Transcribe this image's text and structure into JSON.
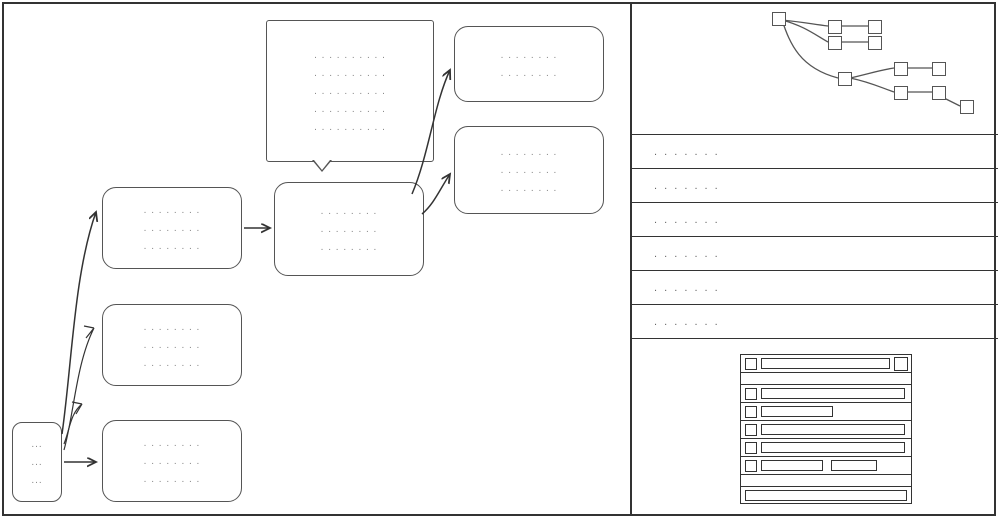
{
  "placeholder_line": ". . . . . . . . .",
  "row_placeholder": ". . . . . . .",
  "flow": {
    "root": {
      "lines": [
        "...",
        "...",
        "..."
      ]
    },
    "n1": {
      "lines": [
        ". . . . . . . .",
        ". . . . . . . .",
        ". . . . . . . ."
      ]
    },
    "n2": {
      "lines": [
        ". . . . . . . .",
        ". . . . . . . .",
        ". . . . . . . ."
      ]
    },
    "n3": {
      "lines": [
        ". . . . . . . .",
        ". . . . . . . .",
        ". . . . . . . ."
      ]
    },
    "center": {
      "lines": [
        ". . . . . . . .",
        ". . . . . . . .",
        ". . . . . . . ."
      ]
    },
    "top": {
      "lines": [
        ". . . . . . . .",
        ". . . . . . . ."
      ]
    },
    "bot": {
      "lines": [
        ". . . . . . . .",
        ". . . . . . . .",
        ". . . . . . . ."
      ]
    },
    "popup": {
      "lines": [
        ". . . . . . . . . .",
        ". . . . . . . . . .",
        ". . . . . . . . . .",
        ". . . . . . . . . .",
        ". . . . . . . . . ."
      ]
    }
  },
  "rows": [
    ". . . . . . .",
    ". . . . . . .",
    ". . . . . . .",
    ". . . . . . .",
    ". . . . . . .",
    ". . . . . . ."
  ]
}
